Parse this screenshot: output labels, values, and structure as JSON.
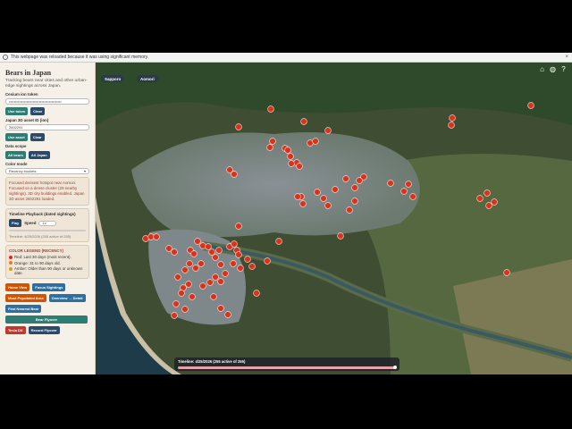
{
  "browser_notice": "This webpage was reloaded because it was using significant memory.",
  "sidebar": {
    "title": "Bears in Japan",
    "subtitle": "Tracking bears near cities and other urban-edge sightings across Japan.",
    "cesium_label": "Cesium ion token",
    "cesium_value": "••••••••••••••••••••••••••••••••••••••••••",
    "use_token": "Use token",
    "clear": "Clear",
    "asset_label": "Japan 3D asset ID (ion)",
    "asset_value": "2602291",
    "use_asset": "Use asset",
    "clear2": "Clear",
    "scope_label": "Data scope",
    "scope_a": "All bears",
    "scope_b": "All Japan",
    "color_label": "Color mode",
    "color_value": "Recency buckets",
    "status": "Focused densest hotspot near Aomori. Focused on a dense cluster (29 nearby sightings). 3D city buildings enabled. Japan 3D asset 2602291 loaded.",
    "timeline_label": "Timeline Playback (dated sightings)",
    "play": "Play",
    "speed_label": "Speed",
    "speed_value": "1x",
    "timeline_status": "Timeline: 4/25/2026 (255 active of 255)",
    "legend_title": "COLOR LEGEND (RECENCY)",
    "legend": [
      {
        "text": "Red: Last 30 days (most recent).",
        "color": "#d62b1e"
      },
      {
        "text": "Orange: 31 to 90 days old.",
        "color": "#e67e22"
      },
      {
        "text": "Amber: Older than 90 days or unknown date.",
        "color": "#d4a017"
      }
    ],
    "home_view": "Home View",
    "focus_sightings": "Focus Sightings",
    "most_populated": "Most Populated Area",
    "overview_detail": "Overview → Detail",
    "find_nearest": "Find Nearest Bear",
    "bear_flyover": "Bear Flyover",
    "tesla_dx": "Tesla DX",
    "record_flyover": "Record Flyover"
  },
  "map": {
    "labels": {
      "sapporo": "Sapporo",
      "aomori": "Aomori"
    },
    "timeline_text": "Timeline: 4/25/2026 (255 active of 255)"
  },
  "colors": {
    "marker": "#d9321f",
    "marker_stroke": "#ffe7d6",
    "sidebar_bg": "#f6f1e8"
  }
}
